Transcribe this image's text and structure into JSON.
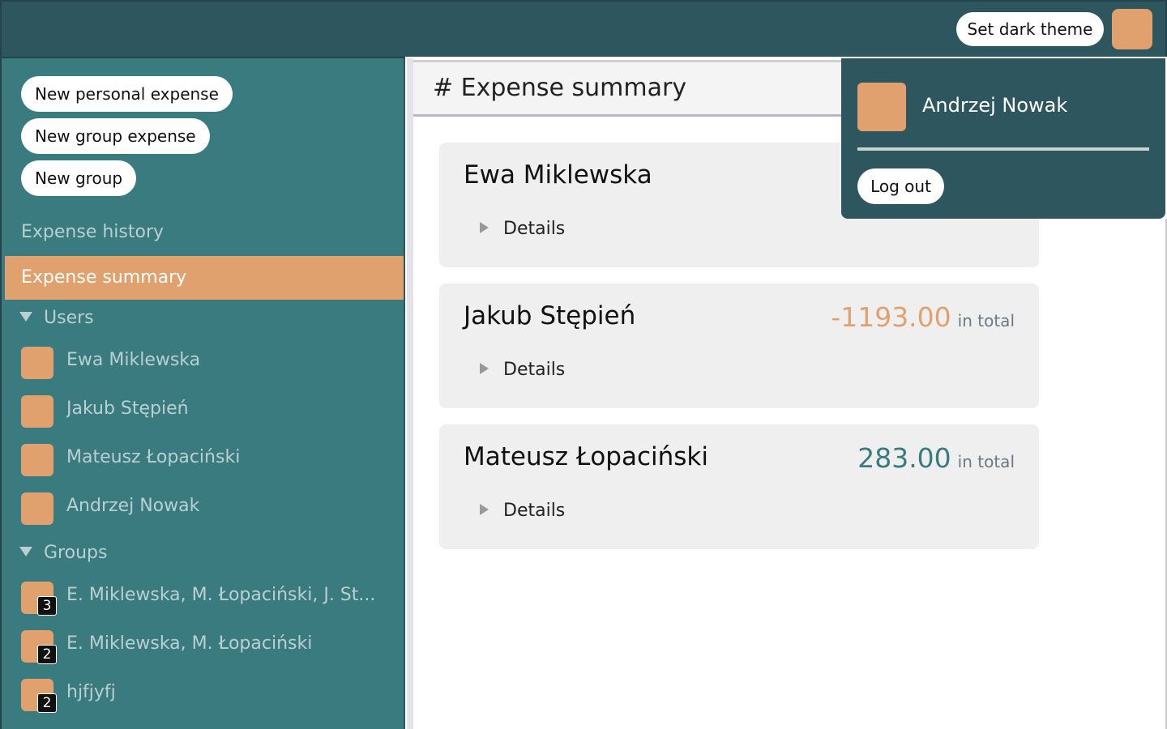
{
  "header": {
    "theme_button": "Set dark theme"
  },
  "sidebar": {
    "actions": [
      {
        "label": "New personal expense"
      },
      {
        "label": "New group expense"
      },
      {
        "label": "New group"
      }
    ],
    "nav": {
      "history": "Expense history",
      "summary": "Expense summary"
    },
    "users_heading": "Users",
    "users": [
      {
        "label": "Ewa Miklewska"
      },
      {
        "label": "Jakub Stępień"
      },
      {
        "label": "Mateusz Łopaciński"
      },
      {
        "label": "Andrzej Nowak"
      }
    ],
    "groups_heading": "Groups",
    "groups": [
      {
        "label": "E. Miklewska, M. Łopaciński, J. St...",
        "count": "3"
      },
      {
        "label": "E. Miklewska, M. Łopaciński",
        "count": "2"
      },
      {
        "label": "hjfjyfj",
        "count": "2"
      }
    ]
  },
  "main": {
    "title": "# Expense summary",
    "cards": [
      {
        "name": "Ewa Miklewska",
        "amount": "",
        "suffix": "",
        "details": "Details"
      },
      {
        "name": "Jakub Stępień",
        "amount": "-1193.00",
        "suffix": "in total",
        "details": "Details"
      },
      {
        "name": "Mateusz Łopaciński",
        "amount": "283.00",
        "suffix": "in total",
        "details": "Details"
      }
    ]
  },
  "dropdown": {
    "user_name": "Andrzej Nowak",
    "logout": "Log out"
  },
  "colors": {
    "topbar": "#2d565e",
    "sidebar": "#3a7b80",
    "accent": "#e0a16e",
    "negative": "#e0a16e",
    "positive": "#3a7b80"
  }
}
